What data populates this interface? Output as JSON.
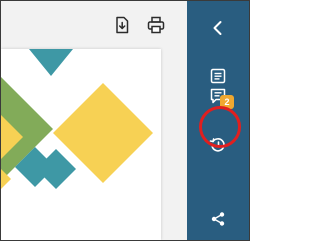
{
  "toolbar": {
    "download_icon": "download-icon",
    "print_icon": "print-icon"
  },
  "sidebar": {
    "collapse_icon": "chevron-left-icon",
    "items": [
      {
        "name": "document-list-icon"
      },
      {
        "name": "comments-icon",
        "badge": "2"
      },
      {
        "name": "history-icon"
      },
      {
        "name": "share-icon"
      }
    ]
  },
  "colors": {
    "sidebar_bg": "#295d80",
    "badge_bg": "#f0a830",
    "highlight_ring": "#e01f1f",
    "art_yellow": "#f7d154",
    "art_teal": "#3e98a5",
    "art_green": "#82ab59"
  }
}
